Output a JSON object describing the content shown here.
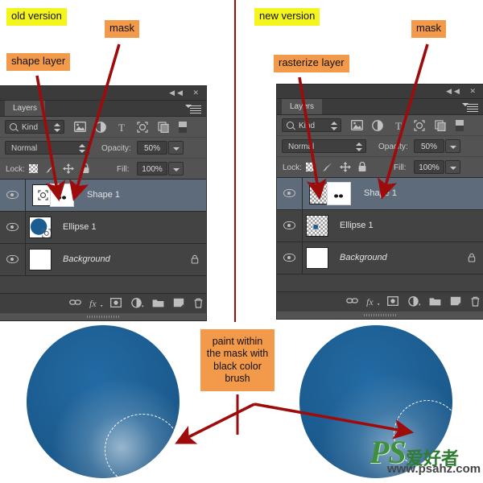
{
  "meta": {
    "accent_red": "#9e0b0b",
    "callout_yellow": "#f5f51e",
    "callout_orange": "#f2994a",
    "panel_bg": "#535353",
    "layer_bg": "#434343",
    "layer_selected_bg": "#5e6b7a",
    "ball_blue": "#1c5d91"
  },
  "callouts": {
    "old_version": "old version",
    "new_version": "new version",
    "mask_left": "mask",
    "mask_right": "mask",
    "shape_layer": "shape layer",
    "rasterize_layer": "rasterize layer",
    "paint_note": "paint within the mask with black color brush"
  },
  "panel_left": {
    "tab_label": "Layers",
    "window_controls": [
      "collapse-icon",
      "close-icon"
    ],
    "panel_menu": "panel-menu-icon",
    "filter": {
      "kind_label": "Kind",
      "search_icon": "search-icon",
      "icons": [
        "pixel-filter-icon",
        "adjustment-filter-icon",
        "type-filter-icon",
        "shape-filter-icon",
        "smart-object-filter-icon",
        "filter-toggle-icon"
      ]
    },
    "blend": {
      "mode": "Normal",
      "opacity_label": "Opacity:",
      "opacity_value": "50%",
      "fill_label": "Fill:",
      "fill_value": "100%"
    },
    "lock": {
      "label": "Lock:",
      "icons": [
        "lock-transparency-icon",
        "lock-image-icon",
        "lock-position-icon",
        "lock-all-icon"
      ]
    },
    "layers": [
      {
        "name": "Shape 1",
        "selected": true,
        "italic": false,
        "locked": false,
        "visible": true,
        "thumb_type": "vector-shape",
        "mask_type": "white-mask-painted",
        "linked": true
      },
      {
        "name": "Ellipse 1",
        "selected": false,
        "italic": false,
        "locked": false,
        "visible": true,
        "thumb_type": "blue-ellipse-vector",
        "mask_type": "none",
        "linked": false
      },
      {
        "name": "Background",
        "selected": false,
        "italic": true,
        "locked": true,
        "visible": true,
        "thumb_type": "white",
        "mask_type": "none",
        "linked": false
      }
    ],
    "bottom_icons": [
      "link-layers-icon",
      "layer-style-fx-icon",
      "add-mask-icon",
      "adjustment-layer-icon",
      "new-group-icon",
      "new-layer-icon",
      "delete-layer-icon"
    ]
  },
  "panel_right": {
    "tab_label": "Layers",
    "window_controls": [
      "collapse-icon",
      "close-icon"
    ],
    "panel_menu": "panel-menu-icon",
    "filter": {
      "kind_label": "Kind",
      "search_icon": "search-icon",
      "icons": [
        "pixel-filter-icon",
        "adjustment-filter-icon",
        "type-filter-icon",
        "shape-filter-icon",
        "smart-object-filter-icon",
        "filter-toggle-icon"
      ]
    },
    "blend": {
      "mode": "Normal",
      "opacity_label": "Opacity:",
      "opacity_value": "50%",
      "fill_label": "Fill:",
      "fill_value": "100%"
    },
    "lock": {
      "label": "Lock:",
      "icons": [
        "lock-transparency-icon",
        "lock-image-icon",
        "lock-position-icon",
        "lock-all-icon"
      ]
    },
    "layers": [
      {
        "name": "Shape 1",
        "selected": true,
        "italic": false,
        "locked": false,
        "visible": true,
        "thumb_type": "transparent-raster",
        "mask_type": "white-mask-painted",
        "linked": true
      },
      {
        "name": "Ellipse 1",
        "selected": false,
        "italic": false,
        "locked": false,
        "visible": true,
        "thumb_type": "transparent-dot",
        "mask_type": "none",
        "linked": false
      },
      {
        "name": "Background",
        "selected": false,
        "italic": true,
        "locked": true,
        "visible": true,
        "thumb_type": "white",
        "mask_type": "none",
        "linked": false
      }
    ],
    "bottom_icons": [
      "link-layers-icon",
      "layer-style-fx-icon",
      "add-mask-icon",
      "adjustment-layer-icon",
      "new-group-icon",
      "new-layer-icon",
      "delete-layer-icon"
    ]
  },
  "artwork": {
    "left_ball_color": "#1c5d91",
    "right_ball_color": "#1c5d91",
    "selection_outline": "dashed-white-circle"
  },
  "watermark": {
    "ps": "PS",
    "chinese": "爱好者",
    "url": "www.psahz.com"
  }
}
